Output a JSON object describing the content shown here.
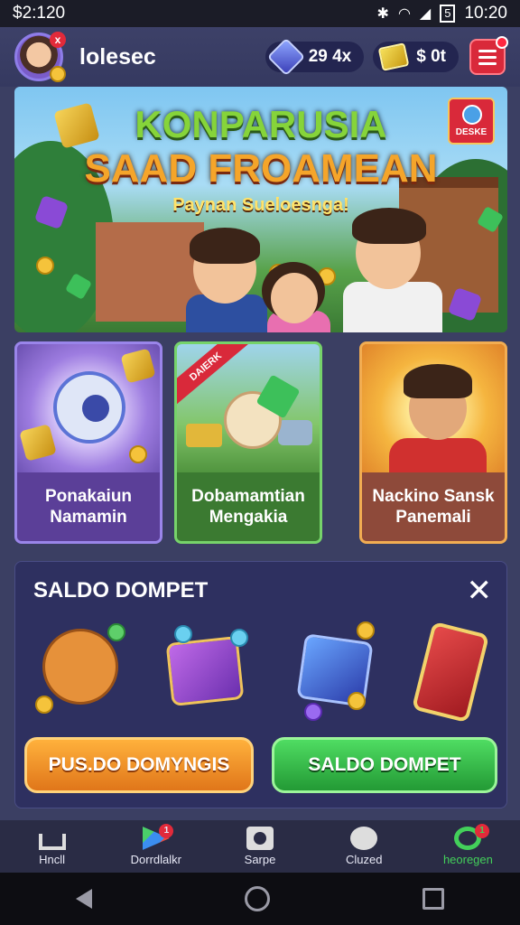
{
  "status": {
    "left_text": "$2:120",
    "time": "10:20",
    "battery": "5"
  },
  "header": {
    "username": "lolesec",
    "gems": "29 4x",
    "gold": "$ 0t",
    "avatar_badge": "x"
  },
  "banner": {
    "title_line1": "KONPARUSIA",
    "title_line2": "SAAD FROAMEAN",
    "subtitle": "Paynan Sueloesnga!",
    "badge_label": "DESKE"
  },
  "games": [
    {
      "title_line1": "Ponakaiun",
      "title_line2": "Namamin"
    },
    {
      "title_line1": "Dobamamtian",
      "title_line2": "Mengakia",
      "ribbon": "DAIERK"
    },
    {
      "title_line1": "Nackino Sansk",
      "title_line2": "Panemali"
    }
  ],
  "wallet": {
    "title": "SALDO DOMPET",
    "close": "✕",
    "btn_left": "PUS.DO DOMYNGIS",
    "btn_right": "SALDO DOMPET"
  },
  "bottom_nav": {
    "items": [
      {
        "label": "Hncll",
        "icon": "home-icon"
      },
      {
        "label": "Dorrdlalkr",
        "icon": "play-store-icon",
        "badge": "1"
      },
      {
        "label": "Sarpe",
        "icon": "camera-icon"
      },
      {
        "label": "Cluzed",
        "icon": "chat-icon"
      },
      {
        "label": "heoregen",
        "icon": "link-icon",
        "badge": "1"
      }
    ]
  },
  "colors": {
    "background": "#3b3f63",
    "accent_green": "#43d05a",
    "accent_orange": "#f5a52a",
    "badge_red": "#e22a3a"
  }
}
